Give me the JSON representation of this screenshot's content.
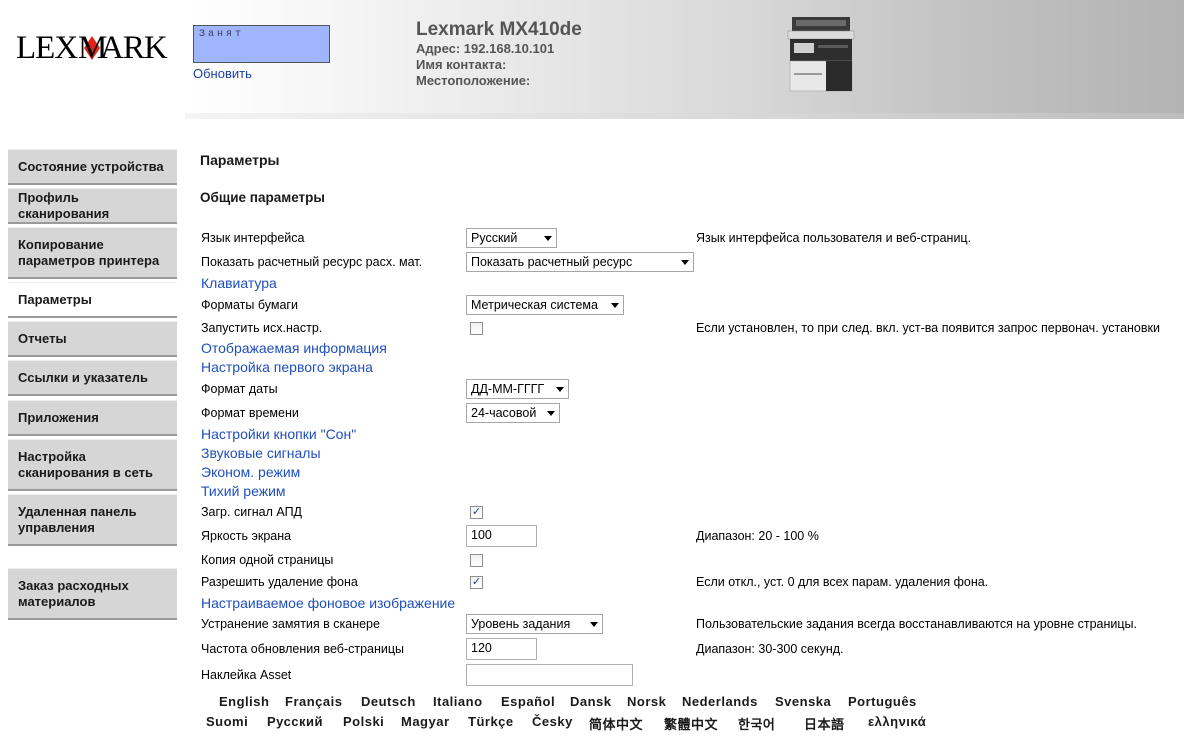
{
  "header": {
    "logo_text": "LEXMARK",
    "logo_tm": "TM",
    "status_text": "Занят",
    "refresh_label": "Обновить",
    "printer_title": "Lexmark MX410de",
    "address_line": "Адрес: 192.168.10.101",
    "contact_line": "Имя контакта:",
    "location_line": "Местоположение:"
  },
  "sidebar": {
    "items": [
      {
        "label": "Состояние устройства",
        "active": false
      },
      {
        "label": "Профиль сканирования",
        "active": false
      },
      {
        "label": "Копирование параметров принтера",
        "active": false
      },
      {
        "label": "Параметры",
        "active": true
      },
      {
        "label": "Отчеты",
        "active": false
      },
      {
        "label": "Ссылки и указатель",
        "active": false
      },
      {
        "label": "Приложения",
        "active": false
      },
      {
        "label": "Настройка сканирования в сеть",
        "active": false
      },
      {
        "label": "Удаленная панель управления",
        "active": false
      },
      {
        "label": "Заказ расходных материалов",
        "active": false
      }
    ]
  },
  "main": {
    "page_title": "Параметры",
    "section_title": "Общие параметры",
    "settings": {
      "language": {
        "label": "Язык интерфейса",
        "value": "Русский",
        "desc": "Язык интерфейса пользователя и веб-страниц."
      },
      "supply": {
        "label": "Показать расчетный ресурс расх. мат.",
        "value": "Показать расчетный ресурс"
      },
      "keyboard": {
        "label": "Клавиатура"
      },
      "paper_formats": {
        "label": "Форматы бумаги",
        "value": "Метрическая система"
      },
      "run_setup": {
        "label": "Запустить исх.настр.",
        "checked": false,
        "desc": "Если установлен, то при след. вкл. уст-ва появится запрос первонач. установки"
      },
      "displayed_info": {
        "label": "Отображаемая информация"
      },
      "home_screen": {
        "label": "Настройка первого экрана"
      },
      "date_format": {
        "label": "Формат даты",
        "value": "ДД-ММ-ГГГГ"
      },
      "time_format": {
        "label": "Формат времени",
        "value": "24-часовой"
      },
      "sleep_button": {
        "label": "Настройки кнопки \"Сон\""
      },
      "audio": {
        "label": "Звуковые сигналы"
      },
      "eco_mode": {
        "label": "Эконом. режим"
      },
      "quiet_mode": {
        "label": "Тихий режим"
      },
      "adf_signal": {
        "label": "Загр. сигнал АПД",
        "checked": true
      },
      "brightness": {
        "label": "Яркость экрана",
        "value": "100",
        "desc": "Диапазон: 20 - 100 %"
      },
      "one_page_copy": {
        "label": "Копия одной страницы",
        "checked": false
      },
      "bg_removal": {
        "label": "Разрешить удаление фона",
        "checked": true,
        "desc": "Если откл., уст. 0 для всех парам. удаления фона."
      },
      "custom_bg": {
        "label": "Настраиваемое фоновое изображение"
      },
      "scanner_jam": {
        "label": "Устранение замятия в сканере",
        "value": "Уровень задания",
        "desc": "Пользовательские задания всегда восстанавливаются на уровне страницы."
      },
      "refresh_rate": {
        "label": "Частота обновления веб-страницы",
        "value": "120",
        "desc": "Диапазон: 30-300 секунд."
      },
      "asset_tag": {
        "label": "Наклейка Asset",
        "value": ""
      }
    }
  },
  "languages": {
    "row1": [
      "English",
      "Français",
      "Deutsch",
      "Italiano",
      "Español",
      "Dansk",
      "Norsk",
      "Nederlands",
      "Svenska",
      "Português"
    ],
    "row2": [
      "Suomi",
      "Русский",
      "Polski",
      "Magyar",
      "Türkçe",
      "Česky",
      "简体中文",
      "繁體中文",
      "한국어",
      "日本語",
      "ελληνικά"
    ]
  },
  "colors": {
    "status_box": "#9fb6ff",
    "link": "#1f4fbf",
    "nav_bg": "#d6d6d6"
  }
}
